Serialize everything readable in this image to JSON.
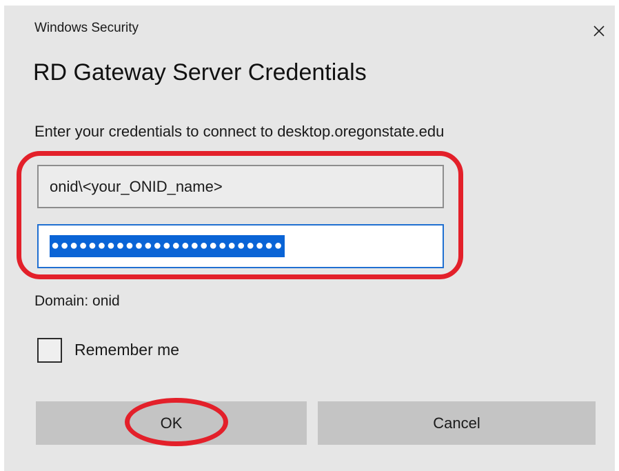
{
  "window": {
    "title": "Windows Security"
  },
  "dialog": {
    "heading": "RD Gateway Server Credentials",
    "instruction": "Enter your credentials to connect to desktop.oregonstate.edu",
    "username_value": "onid\\<your_ONID_name>",
    "password_mask": "●●●●●●●●●●●●●●●●●●●●●●●●●",
    "domain_text": "Domain: onid",
    "remember_label": "Remember me",
    "remember_checked": false
  },
  "buttons": {
    "ok_label": "OK",
    "cancel_label": "Cancel"
  },
  "icons": {
    "close": "close-icon"
  },
  "colors": {
    "annotation_red": "#e3202a",
    "selection_blue": "#0a64d6",
    "dialog_bg": "#e6e6e6",
    "button_bg": "#c4c4c4"
  }
}
